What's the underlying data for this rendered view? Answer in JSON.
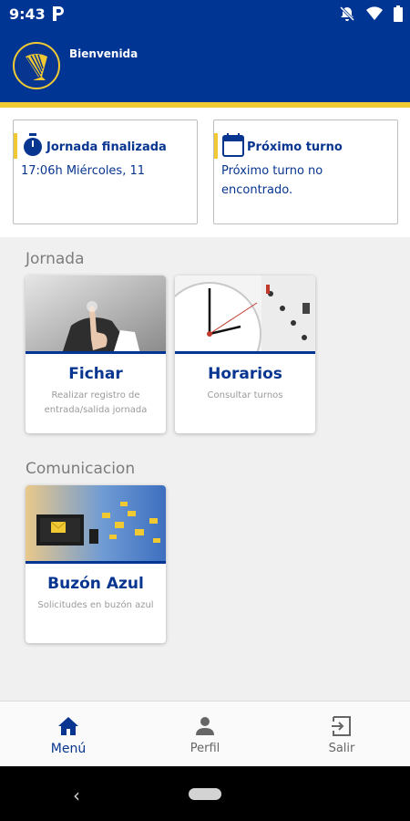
{
  "status_bar": {
    "time": "9:43",
    "notification_icon": "parking-app-icon",
    "icons": [
      "notifications-off-icon",
      "wifi-icon",
      "battery-icon"
    ]
  },
  "header": {
    "welcome_text": "Bienvenida",
    "logo_icon": "harp-logo-icon"
  },
  "cards": {
    "jornada": {
      "title": "Jornada finalizada",
      "text": "17:06h Miércoles, 11",
      "icon": "stopwatch-icon"
    },
    "turno": {
      "title": "Próximo turno",
      "text": "Próximo turno no encontrado.",
      "icon": "calendar-icon"
    }
  },
  "sections": {
    "jornada": {
      "title": "Jornada",
      "tiles": [
        {
          "title": "Fichar",
          "subtitle": "Realizar registro de entrada/salida jornada",
          "image": "touch-screen-photo"
        },
        {
          "title": "Horarios",
          "subtitle": "Consultar turnos",
          "image": "clock-calendar-photo"
        }
      ]
    },
    "comunicacion": {
      "title": "Comunicacion",
      "tiles": [
        {
          "title": "Buzón Azul",
          "subtitle": "Solicitudes en buzón azul",
          "image": "mail-world-map-image"
        }
      ]
    }
  },
  "bottom_nav": {
    "items": [
      {
        "label": "Menú",
        "icon": "home-icon",
        "active": true
      },
      {
        "label": "Perfil",
        "icon": "person-icon",
        "active": false
      },
      {
        "label": "Salir",
        "icon": "exit-icon",
        "active": false
      }
    ]
  },
  "colors": {
    "brand_blue": "#003594",
    "brand_gold": "#f1c933",
    "text_blue": "#073590",
    "muted_gray": "#7d7d7d"
  }
}
